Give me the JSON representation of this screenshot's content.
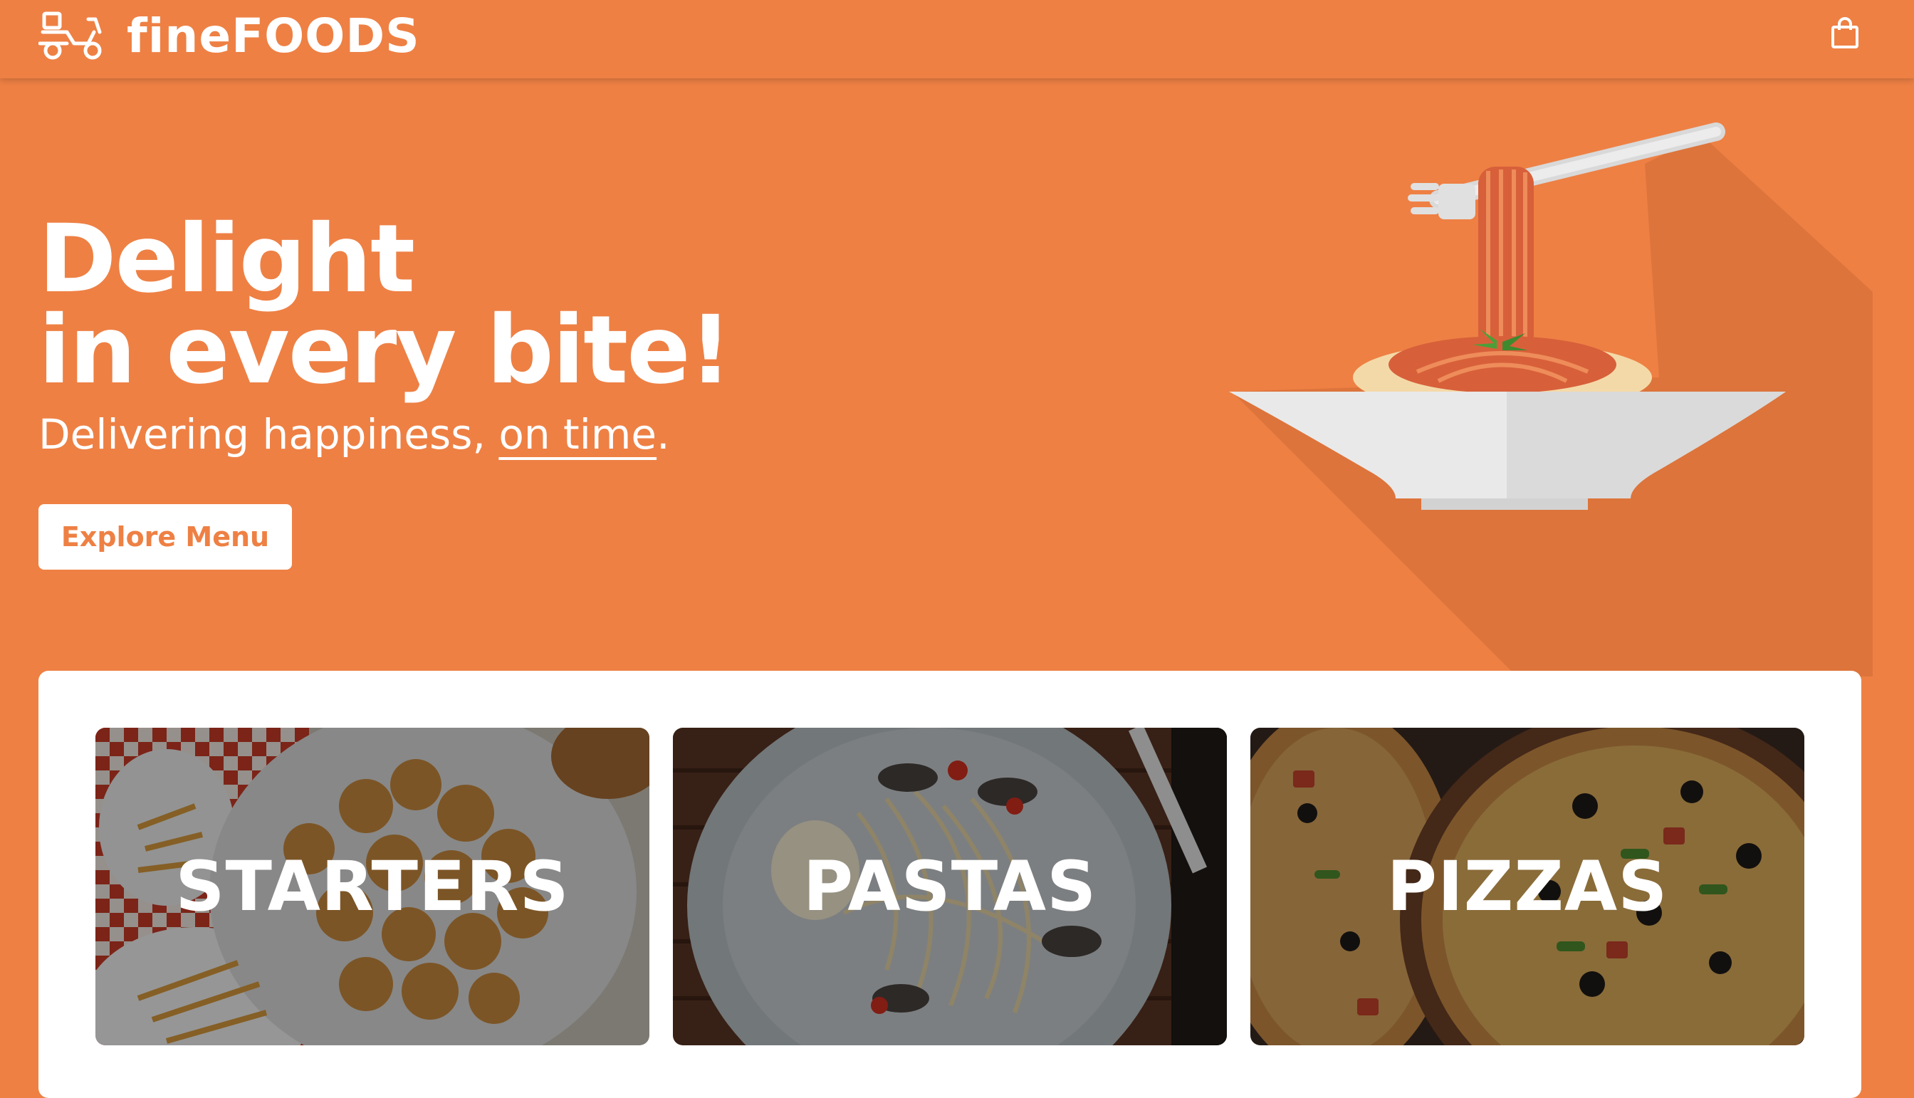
{
  "header": {
    "brand": "finefoods",
    "brand_display": "fineFOODS",
    "icons": {
      "logo": "scooter-delivery-icon",
      "cart": "shopping-bag-icon"
    }
  },
  "hero": {
    "title_line1": "Delight",
    "title_line2": "in every bite!",
    "tagline_prefix": "Delivering happiness, ",
    "tagline_emphasis": "on time",
    "tagline_suffix": ".",
    "cta_label": "Explore Menu",
    "illustration": "pasta-bowl-with-fork-illustration"
  },
  "categories": [
    {
      "label": "STARTERS",
      "image": "chicken-nuggets-and-fries-photo"
    },
    {
      "label": "PASTAS",
      "image": "seafood-spaghetti-photo"
    },
    {
      "label": "PIZZAS",
      "image": "loaded-pizza-photo"
    }
  ],
  "colors": {
    "brand_orange": "#ee8044",
    "panel_white": "#ffffff",
    "text_white": "#ffffff"
  }
}
